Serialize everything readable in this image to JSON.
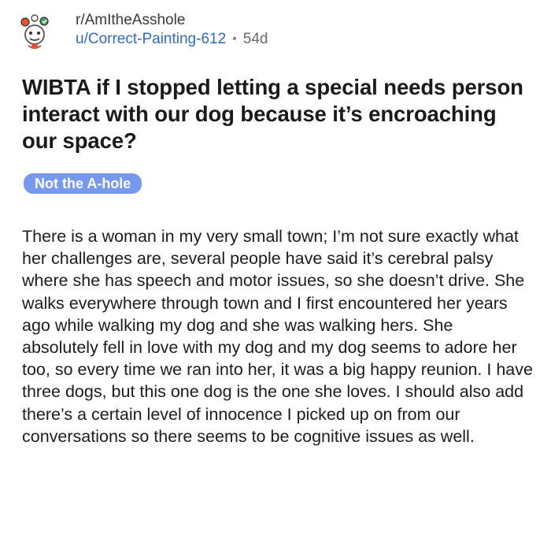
{
  "post": {
    "subreddit": "r/AmItheAsshole",
    "author": "u/Correct-Painting-612",
    "separator": "•",
    "age": "54d",
    "title": "WIBTA if I stopped letting a special needs person interact with our dog because it’s encroaching our space?",
    "flair": "Not the A-hole",
    "body": "There is a woman in my very small town; I’m not sure exactly what her challenges are, several people have said it’s cerebral palsy where she has speech and motor issues, so she doesn’t drive. She walks everywhere through town and I first encountered her years ago while walking my dog and she was walking hers. She absolutely fell in love with my dog and my dog seems to adore her too, so every time we ran into her, it was a big happy reunion. I have three dogs, but this one dog is the one she loves. I should also add there’s a certain level of innocence I picked up on from our conversations so there seems to be cognitive issues as well."
  },
  "colors": {
    "flair_bg": "#7699ef",
    "author_link": "#2f6ac2",
    "avatar_accent": "#e8532b",
    "avatar_green": "#46a05a"
  },
  "icons": {
    "avatar": "subreddit-avatar-icon"
  }
}
